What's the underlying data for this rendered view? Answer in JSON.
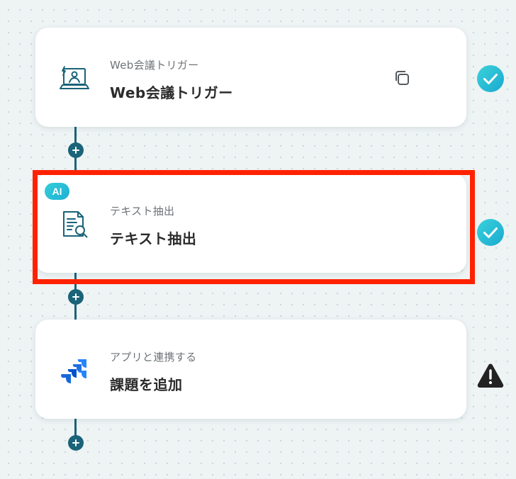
{
  "steps": [
    {
      "subtitle": "Web会議トリガー",
      "title": "Web会議トリガー",
      "icon": "web-meeting-trigger-icon",
      "status": "completed"
    },
    {
      "badge": "AI",
      "subtitle": "テキスト抽出",
      "title": "テキスト抽出",
      "icon": "document-search-icon",
      "status": "completed",
      "highlighted": true
    },
    {
      "subtitle": "アプリと連携する",
      "title": "課題を追加",
      "icon": "jira-icon",
      "status": "warning"
    }
  ],
  "colors": {
    "connector": "#1a6378",
    "success": "#2bc5d6",
    "warning": "#222222",
    "highlight": "#ff2200",
    "jira_blue": "#2684ff"
  }
}
